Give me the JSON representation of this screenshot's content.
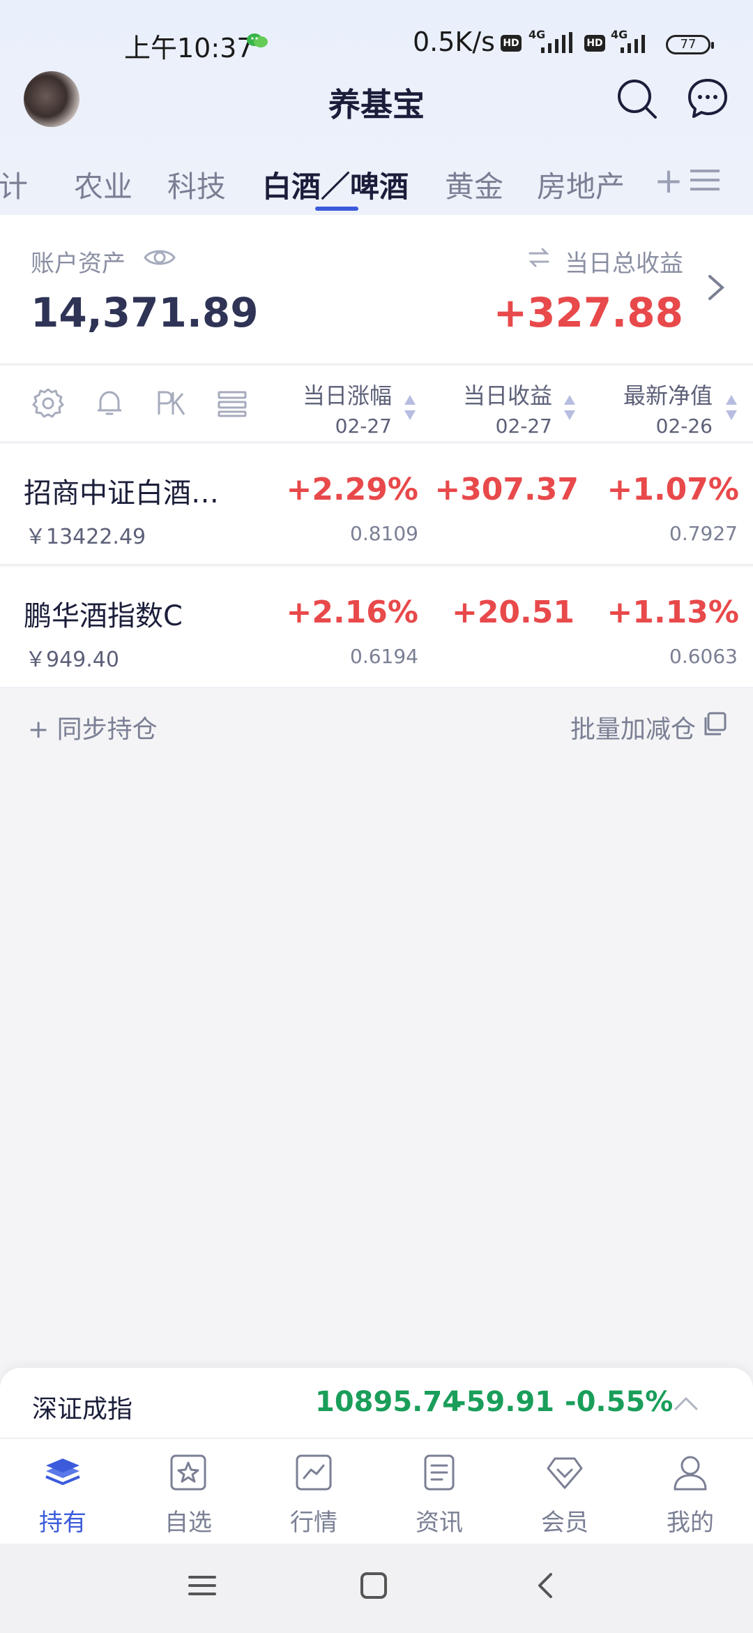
{
  "status_bar": {
    "time": "上午10:37",
    "net_speed": "0.5K/s",
    "hd_label": "HD",
    "net_type": "4G",
    "battery": "77"
  },
  "header": {
    "title": "养基宝",
    "avatar": "avatar"
  },
  "tabs": {
    "items": [
      {
        "label": "合计",
        "active": false
      },
      {
        "label": "农业",
        "active": false
      },
      {
        "label": "科技",
        "active": false
      },
      {
        "label": "白酒／啤酒",
        "active": true
      },
      {
        "label": "黄金",
        "active": false
      },
      {
        "label": "房地产",
        "active": false
      }
    ],
    "add_label": "+",
    "accent_color": "#3b5bdb"
  },
  "account": {
    "assets_label": "账户资产",
    "assets_value": "14,371.89",
    "daily_label": "当日总收益",
    "daily_value": "+327.88"
  },
  "table": {
    "columns": [
      {
        "title": "当日涨幅",
        "date": "02-27"
      },
      {
        "title": "当日收益",
        "date": "02-27"
      },
      {
        "title": "最新净值",
        "date": "02-26"
      }
    ],
    "rows": [
      {
        "name": "招商中证白酒…",
        "amount": "￥13422.49",
        "change_pct": "+2.29%",
        "nav_est": "0.8109",
        "daily_gain": "+307.37",
        "latest_pct": "+1.07%",
        "latest_nav": "0.7927"
      },
      {
        "name": "鹏华酒指数C",
        "amount": "￥949.40",
        "change_pct": "+2.16%",
        "nav_est": "0.6194",
        "daily_gain": "+20.51",
        "latest_pct": "+1.13%",
        "latest_nav": "0.6063"
      }
    ],
    "up_color": "#e8494b"
  },
  "footer": {
    "sync_label": "+ 同步持仓",
    "batch_label": "批量加减仓"
  },
  "ticker": {
    "name": "深证成指",
    "value": "10895.74",
    "change": "-59.91",
    "change_pct": "-0.55%",
    "down_color": "#1a9e5a"
  },
  "bottom_nav": {
    "items": [
      {
        "label": "持有",
        "icon": "layers-icon"
      },
      {
        "label": "自选",
        "icon": "star-icon"
      },
      {
        "label": "行情",
        "icon": "chart-icon"
      },
      {
        "label": "资讯",
        "icon": "news-icon"
      },
      {
        "label": "会员",
        "icon": "diamond-icon"
      },
      {
        "label": "我的",
        "icon": "user-icon"
      }
    ]
  }
}
